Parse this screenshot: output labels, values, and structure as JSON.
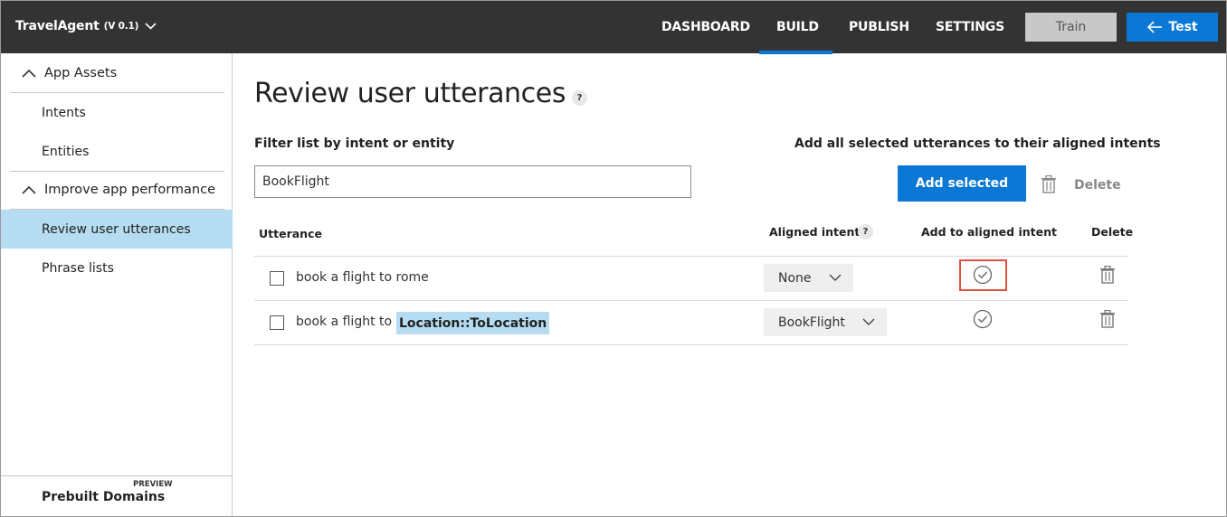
{
  "header": {
    "app_name": "TravelAgent",
    "version": "(V 0.1)",
    "nav": [
      "DASHBOARD",
      "BUILD",
      "PUBLISH",
      "SETTINGS"
    ],
    "active_nav": "BUILD",
    "train_label": "Train",
    "test_label": "Test",
    "accent_color": "#0a78d4"
  },
  "sidebar": {
    "sections": [
      {
        "label": "App Assets",
        "items": [
          "Intents",
          "Entities"
        ]
      },
      {
        "label": "Improve app performance",
        "items": [
          "Review user utterances",
          "Phrase lists"
        ]
      }
    ],
    "active_item": "Review user utterances",
    "prebuilt_label": "Prebuilt Domains",
    "preview_badge": "PREVIEW"
  },
  "main": {
    "title": "Review user utterances",
    "help_glyph": "?",
    "filter_label": "Filter list by intent or entity",
    "filter_value": "BookFlight",
    "add_all_label": "Add all selected utterances to their aligned intents",
    "add_selected_label": "Add selected",
    "delete_label": "Delete",
    "table": {
      "columns": [
        "Utterance",
        "Aligned intent",
        "Add to aligned intent",
        "Delete"
      ],
      "rows": [
        {
          "text": "book a flight to rome",
          "entity": "",
          "intent": "None",
          "checked": false
        },
        {
          "text": "book a flight to",
          "entity": "Location::ToLocation",
          "intent": "BookFlight",
          "checked": false
        }
      ]
    }
  }
}
